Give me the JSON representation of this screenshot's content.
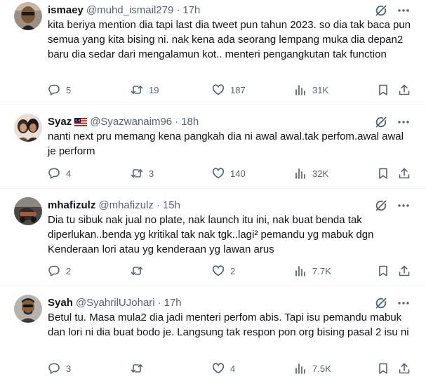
{
  "tweets": [
    {
      "name": "ismaey",
      "handle": "@muhd_ismail279",
      "time": "17h",
      "text": "kita beriya mention dia tapi last dia tweet pun tahun 2023. so dia tak baca pun semua yang kita bising ni. nak kena ada seorang lempang muka dia depan2 baru dia sedar dari mengalamun kot.. menteri pengangkutan tak function",
      "replies": "5",
      "reposts": "19",
      "likes": "187",
      "views": "31K"
    },
    {
      "name": "Syaz",
      "flag": "malaysia-flag",
      "handle": "@Syazwanaim96",
      "time": "18h",
      "text": "nanti next pru memang kena pangkah dia ni awal awal.tak perfom.awal awal je perform",
      "replies": "4",
      "reposts": "3",
      "likes": "140",
      "views": "32K"
    },
    {
      "name": "mhafizulz",
      "handle": "@mhafizulz",
      "time": "15h",
      "text": "Dia tu sibuk nak jual no plate, nak launch itu ini, nak buat benda tak diperlukan..benda yg kritikal tak nak tgk..lagi² pemandu yg mabuk dgn Kenderaan lori atau yg kenderaan yg lawan arus",
      "replies": "2",
      "reposts": "",
      "likes": "2",
      "views": "7.7K"
    },
    {
      "name": "Syah",
      "handle": "@SyahrilUJohari",
      "time": "17h",
      "text": "Betul tu. Masa mula2 dia jadi menteri perfom abis. Tapi isu pemandu mabuk dan lori ni dia buat bodo je. Langsung tak respon pon org bising pasal 2 isu ni",
      "replies": "3",
      "reposts": "",
      "likes": "4",
      "views": "7.5K"
    }
  ],
  "icons": {
    "grok": "grok-icon",
    "more": "more-icon",
    "reply": "reply-icon",
    "repost": "repost-icon",
    "like": "like-icon",
    "views": "views-icon",
    "bookmark": "bookmark-icon",
    "share": "share-icon"
  },
  "colors": {
    "text": "#0f1419",
    "secondary": "#536471",
    "divider": "#eff3f4"
  }
}
